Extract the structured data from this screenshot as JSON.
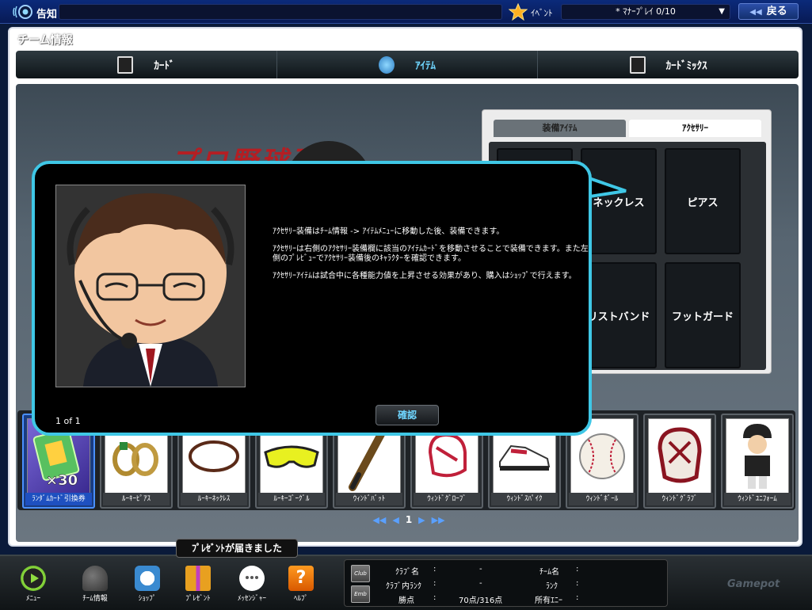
{
  "topbar": {
    "notice_label": "告知",
    "event_label": "ｲﾍﾞﾝﾄ",
    "event_select_value": "* ﾏﾅｰﾌﾟﾚｲ 0/10",
    "back_label": "戻る"
  },
  "panel": {
    "title": "チーム情報",
    "tabs": [
      {
        "label": "ｶｰﾄﾞ",
        "icon": "card-icon",
        "active": false
      },
      {
        "label": "ｱｲﾃﾑ",
        "icon": "items-icon",
        "active": true
      },
      {
        "label": "ｶｰﾄﾞﾐｯｸｽ",
        "icon": "card-mix-icon",
        "active": false
      }
    ]
  },
  "background": {
    "logo_text": "プロ野球列伝"
  },
  "accessory": {
    "tabs": [
      {
        "label": "装備ｱｲﾃﾑ",
        "active": false
      },
      {
        "label": "ｱｸｾｻﾘｰ",
        "active": true
      }
    ],
    "slots": [
      {
        "label": ""
      },
      {
        "label": "ネックレス"
      },
      {
        "label": "ピアス"
      },
      {
        "label": ""
      },
      {
        "label": "リストバンド"
      },
      {
        "label": "フットガード"
      }
    ]
  },
  "items": [
    {
      "name": "ﾗﾝﾀﾞﾑｶｰﾄﾞ引換券",
      "icon": "card-ticket-icon",
      "selected": true,
      "badge": "×30"
    },
    {
      "name": "ﾙｰｷｰﾋﾟｱｽ",
      "icon": "earring-icon",
      "selected": false
    },
    {
      "name": "ﾙｰｷｰﾈｯｸﾚｽ",
      "icon": "necklace-icon",
      "selected": false
    },
    {
      "name": "ﾙｰｷｰｺﾞｰｸﾞﾙ",
      "icon": "goggles-icon",
      "selected": false
    },
    {
      "name": "ｳｨﾝﾄﾞﾊﾞｯﾄ",
      "icon": "bat-icon",
      "selected": false
    },
    {
      "name": "ｳｨﾝﾄﾞｸﾞﾛｰﾌﾞ",
      "icon": "glove-icon",
      "selected": false
    },
    {
      "name": "ｳｨﾝﾄﾞｽﾊﾟｲｸ",
      "icon": "spike-shoe-icon",
      "selected": false
    },
    {
      "name": "ｳｨﾝﾄﾞﾎﾞｰﾙ",
      "icon": "baseball-icon",
      "selected": false
    },
    {
      "name": "ｳｨﾝﾄﾞｸﾞﾗﾌﾞ",
      "icon": "mitt-icon",
      "selected": false
    },
    {
      "name": "ｳｨﾝﾄﾞﾕﾆﾌｫｰﾑ",
      "icon": "uniform-icon",
      "selected": false
    }
  ],
  "pager": {
    "page": "1"
  },
  "dialog": {
    "paragraphs": [
      "ｱｸｾｻﾘｰ装備はﾁｰﾑ情報 -> ｱｲﾃﾑﾒﾆｭｰに移動した後、装備できます。",
      "ｱｸｾｻﾘｰは右側のｱｸｾｻﾘｰ装備欄に該当のｱｲﾃﾑｶｰﾄﾞを移動させることで装備できます。また左側のﾌﾟﾚﾋﾞｭｰでｱｸｾｻﾘｰ装備後のｷｬﾗｸﾀｰを確認できます。",
      "ｱｸｾｻﾘｰｱｲﾃﾑは試合中に各種能力値を上昇させる効果があり、購入はｼｮｯﾌﾟで行えます。"
    ],
    "page_indicator": "1 of 1",
    "confirm_label": "確認"
  },
  "bottombar": {
    "nav": [
      {
        "label": "ﾒﾆｭｰ",
        "icon": "menu-play-icon"
      },
      {
        "label": "ﾁｰﾑ情報",
        "icon": "helmet-icon"
      },
      {
        "label": "ｼｮｯﾌﾟ",
        "icon": "shop-basket-icon"
      },
      {
        "label": "ﾌﾟﾚｾﾞﾝﾄ",
        "icon": "present-icon"
      },
      {
        "label": "ﾒｯｾﾝｼﾞｬｰ",
        "icon": "messenger-icon"
      },
      {
        "label": "ﾍﾙﾌﾟ",
        "icon": "help-icon"
      }
    ],
    "present_tooltip": "ﾌﾟﾚｾﾞﾝﾄが届きました",
    "club": {
      "club_badge": "Club",
      "emb_badge": "Emb",
      "club_name_label": "ｸﾗﾌﾞ名",
      "club_name_value": "-",
      "club_rank_label": "ｸﾗﾌﾞ内ﾗﾝｸ",
      "club_rank_value": "-",
      "points_label": "勝点",
      "points_value": "70点/316点",
      "team_name_label": "ﾁｰﾑ名",
      "team_name_value": "",
      "rank_label": "ﾗﾝｸ",
      "rank_value": "",
      "money_label": "所有ｴﾆｰ",
      "money_value": ""
    },
    "logo": "Gamepot"
  },
  "colors": {
    "accent_cyan": "#3fc7e6",
    "active_tab_text": "#6fd6ff",
    "selected_item": "#1e50c0"
  }
}
